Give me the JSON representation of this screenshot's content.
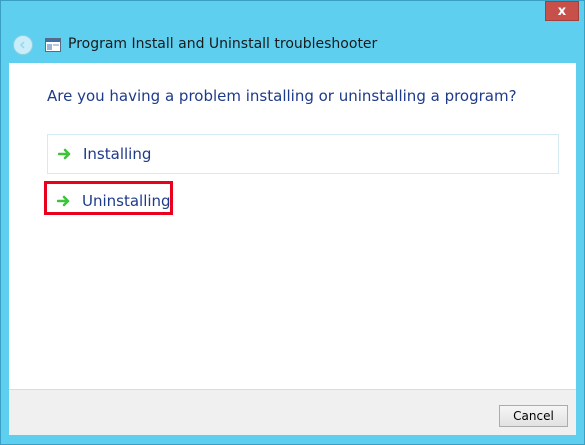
{
  "window": {
    "title": "Program Install and Uninstall troubleshooter",
    "close_glyph": "x"
  },
  "main": {
    "question": "Are you having a problem installing or uninstalling a program?",
    "options": [
      {
        "label": "Installing",
        "icon": "green-arrow-icon"
      },
      {
        "label": "Uninstalling",
        "icon": "green-arrow-icon",
        "highlighted": true
      }
    ]
  },
  "footer": {
    "cancel_label": "Cancel"
  },
  "colors": {
    "chrome": "#5fcff0",
    "link_text": "#1e3b8a",
    "arrow": "#3cc43c",
    "highlight": "#e8001c",
    "close_button": "#c7504a"
  }
}
